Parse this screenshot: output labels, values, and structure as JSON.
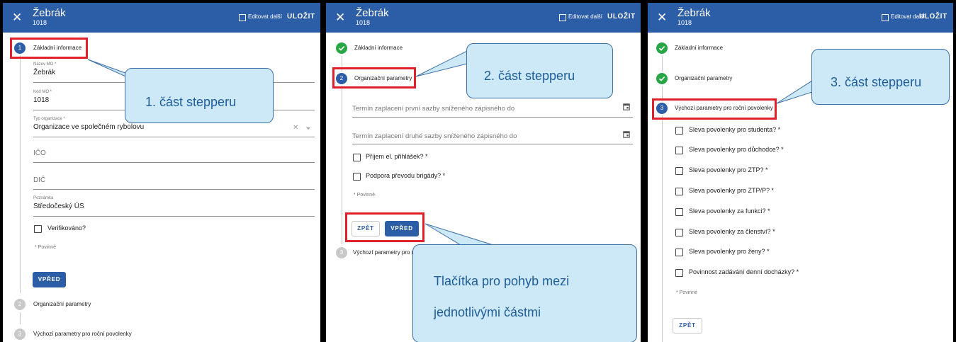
{
  "header": {
    "close_icon": "close-icon",
    "title": "Žebrák",
    "subtitle": "1018",
    "edit_next_label": "Editovat další",
    "save_label": "ULOŽIT"
  },
  "steps": {
    "step1": {
      "number": "1",
      "label": "Základní informace"
    },
    "step2": {
      "number": "2",
      "label": "Organizační parametry"
    },
    "step3": {
      "number": "3",
      "label": "Výchozí parametry pro roční povolenky"
    },
    "step3_truncated": "Výchozí parametry pro ro"
  },
  "panel1": {
    "fields": {
      "name_label": "Název MO *",
      "name_value": "Žebrák",
      "code_label": "Kód MO *",
      "code_value": "1018",
      "orgtype_label": "Typ organizace *",
      "orgtype_value": "Organizace ve společném rybolovu",
      "ico_placeholder": "IČO",
      "dic_placeholder": "DIČ",
      "note_label": "Poznámka",
      "note_value": "Středočeský ÚS"
    },
    "verified_label": "Verifikováno?",
    "required_note": "* Povinné",
    "next_button": "VPŘED",
    "callout": "1. část stepperu"
  },
  "panel2": {
    "date1_placeholder": "Termín zaplacení první sazby sníženého zápisného do",
    "date2_placeholder": "Termín zaplacení druhé sazby sníženého zápisného do",
    "checkboxes": [
      "Příjem el. přihlášek? *",
      "Podpora převodu brigády? *"
    ],
    "required_note": "* Povinné",
    "back_button": "ZPĚT",
    "next_button": "VPŘED",
    "callout": "2. část stepperu",
    "callout_buttons_line1": "Tlačítka pro pohyb mezi",
    "callout_buttons_line2": "jednotlivými částmi"
  },
  "panel3": {
    "checkboxes": [
      "Sleva povolenky pro studenta? *",
      "Sleva povolenky pro důchodce? *",
      "Sleva povolenky pro ZTP? *",
      "Sleva povolenky pro ZTP/P? *",
      "Sleva povolenky za funkci? *",
      "Sleva povolenky za členství? *",
      "Sleva povolenky pro ženy? *",
      "Povinnost zadávání denní docházky? *"
    ],
    "required_note": "* Povinné",
    "back_button": "ZPĚT",
    "callout": "3. část stepperu"
  },
  "colors": {
    "primary": "#2c5ea8",
    "success": "#27a645",
    "highlight": "#e0212b",
    "callout_bg": "#cde8f6",
    "callout_text": "#1f5d9a"
  }
}
